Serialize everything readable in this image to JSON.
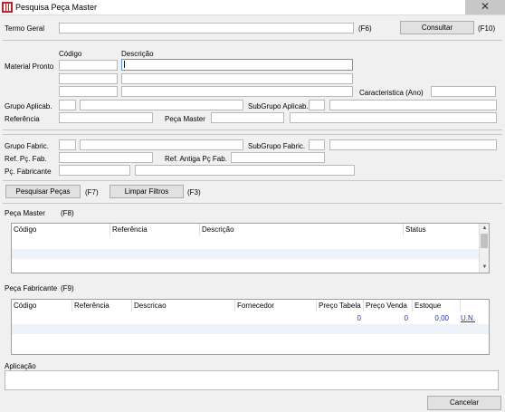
{
  "window": {
    "title": "Pesquisa Peça Master"
  },
  "search": {
    "termo_label": "Termo Geral",
    "termo_shortcut": "(F6)",
    "consultar_label": "Consultar",
    "consultar_shortcut": "(F10)"
  },
  "material": {
    "codigo_header": "Código",
    "descricao_header": "Descrição",
    "material_pronto_label": "Material Pronto",
    "caracteristica_label": "Caracteristica (Ano)",
    "grupo_aplic_label": "Grupo Aplicab.",
    "subgrupo_aplic_label": "SubGrupo Aplicab.",
    "referencia_label": "Referência",
    "peca_master_label": "Peça Master"
  },
  "fabric": {
    "grupo_fabric_label": "Grupo Fabric.",
    "subgrupo_fabric_label": "SubGrupo Fabric.",
    "ref_pc_fab_label": "Ref. Pç. Fab.",
    "ref_antiga_label": "Ref. Antiga Pç Fab.",
    "pc_fabricante_label": "Pç. Fabricante"
  },
  "actions": {
    "pesquisar_label": "Pesquisar Peças",
    "pesquisar_shortcut": "(F7)",
    "limpar_label": "Limpar Filtros",
    "limpar_shortcut": "(F3)"
  },
  "peca_master_grid": {
    "title": "Peça Master",
    "shortcut": "(F8)",
    "columns": [
      "Código",
      "Referência",
      "Descrição",
      "Status"
    ]
  },
  "peca_fabricante_grid": {
    "title": "Peça Fabricante",
    "shortcut": "(F9)",
    "columns": [
      "Código",
      "Referência",
      "Descricao",
      "Fornecedor",
      "Preço Tabela",
      "Preço Venda",
      "Estoque"
    ],
    "totals": {
      "preco_tabela": "0",
      "preco_venda": "0",
      "estoque": "0,00",
      "unidade": "U.N."
    }
  },
  "aplicacao": {
    "label": "Aplicação"
  },
  "footer": {
    "cancelar_label": "Cancelar"
  },
  "icons": {
    "app": "app-icon",
    "close": "close-icon"
  }
}
